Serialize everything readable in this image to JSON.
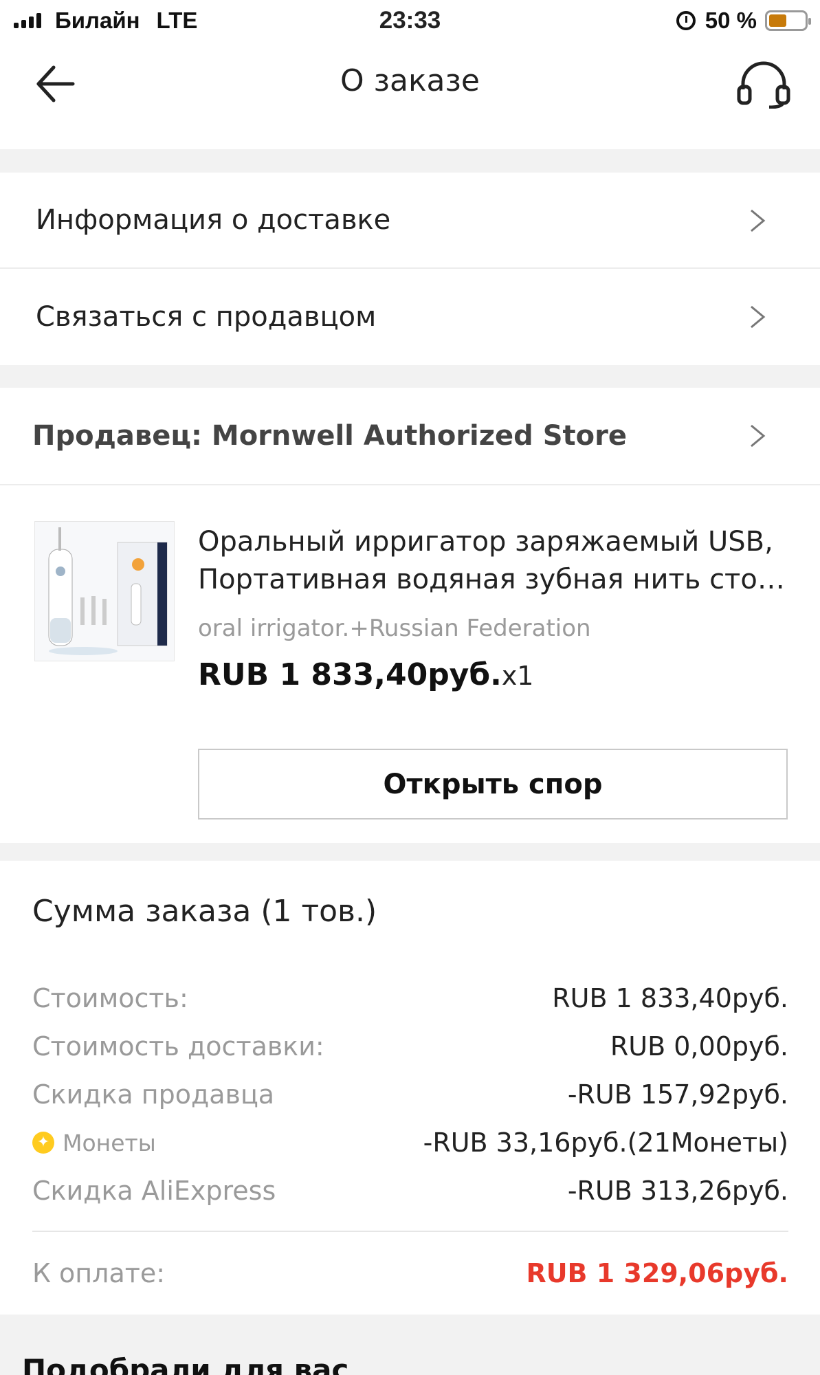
{
  "status_bar": {
    "carrier": "Билайн",
    "network": "LTE",
    "time": "23:33",
    "battery": "50 %",
    "battery_level": 0.5
  },
  "nav": {
    "title": "О заказе",
    "back_icon": "arrow-left-icon",
    "support_icon": "headset-icon"
  },
  "menu": [
    {
      "label": "Информация о доставке"
    },
    {
      "label": "Связаться с продавцом"
    }
  ],
  "seller": {
    "label": "Продавец: Mornwell Authorized Store"
  },
  "product": {
    "title_line1": "Оральный ирригатор заряжаемый USB,",
    "title_line2": "Портативная водяная зубная нить стоматологическая",
    "variant": "oral irrigator.+Russian Federation",
    "price": "RUB 1 833,40руб.",
    "qty": "x1",
    "dispute_button": "Открыть спор"
  },
  "summary": {
    "title": "Сумма заказа (1 тов.)",
    "lines": [
      {
        "label": "Стоимость:",
        "value": "RUB 1 833,40руб."
      },
      {
        "label": "Стоимость доставки:",
        "value": "RUB 0,00руб."
      },
      {
        "label": "Скидка продавца",
        "value": "-RUB 157,92руб."
      },
      {
        "label": "Монеты",
        "value": "-RUB 33,16руб.(21Монеты)"
      },
      {
        "label": "Скидка AliExpress",
        "value": "-RUB 313,26руб."
      }
    ],
    "total_label": "К оплате:",
    "total_value": "RUB 1 329,06руб.",
    "total_color": "#e8392b"
  },
  "recommend": {
    "title": "Подобрали для вас"
  }
}
